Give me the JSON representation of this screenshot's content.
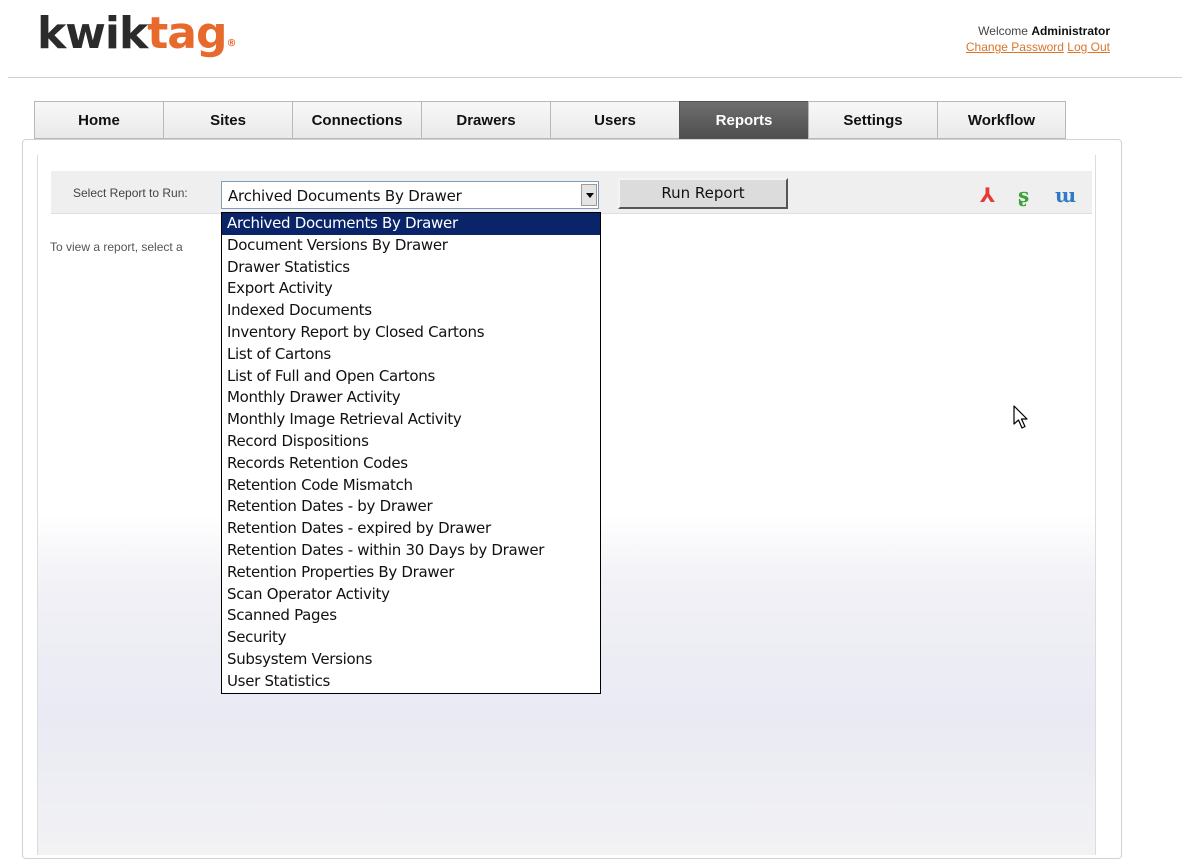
{
  "brand": {
    "prefix": "kwik",
    "suffix": "tag",
    "mark": "®"
  },
  "user": {
    "welcome_text": "Welcome",
    "name": "Administrator",
    "change_password": "Change Password",
    "logout": "Log Out"
  },
  "tabs": [
    {
      "label": "Home",
      "active": false
    },
    {
      "label": "Sites",
      "active": false
    },
    {
      "label": "Connections",
      "active": false
    },
    {
      "label": "Drawers",
      "active": false
    },
    {
      "label": "Users",
      "active": false
    },
    {
      "label": "Reports",
      "active": true
    },
    {
      "label": "Settings",
      "active": false
    },
    {
      "label": "Workflow",
      "active": false
    }
  ],
  "report_toolbar": {
    "select_label": "Select Report to Run:",
    "selected_value": "Archived Documents By Drawer",
    "run_button": "Run Report",
    "export_icons": [
      "pdf-icon",
      "excel-icon",
      "word-icon"
    ]
  },
  "hint_text": "To view a report, select a",
  "dropdown_options": [
    "Archived Documents By Drawer",
    "Document Versions By Drawer",
    "Drawer Statistics",
    "Export Activity",
    "Indexed Documents",
    "Inventory Report by Closed Cartons",
    "List of Cartons",
    "List of Full and Open Cartons",
    "Monthly Drawer Activity",
    "Monthly Image Retrieval Activity",
    "Record Dispositions",
    "Records Retention Codes",
    "Retention Code Mismatch",
    "Retention Dates - by Drawer",
    "Retention Dates - expired by Drawer",
    "Retention Dates - within 30 Days by Drawer",
    "Retention Properties By Drawer",
    "Scan Operator Activity",
    "Scanned Pages",
    "Security",
    "Subsystem Versions",
    "User Statistics"
  ],
  "colors": {
    "brand_dark": "#2b2b2b",
    "brand_orange": "#e8692c",
    "active_tab": "#5a5a5a",
    "selection": "#0a246a",
    "link": "#d9762b"
  }
}
